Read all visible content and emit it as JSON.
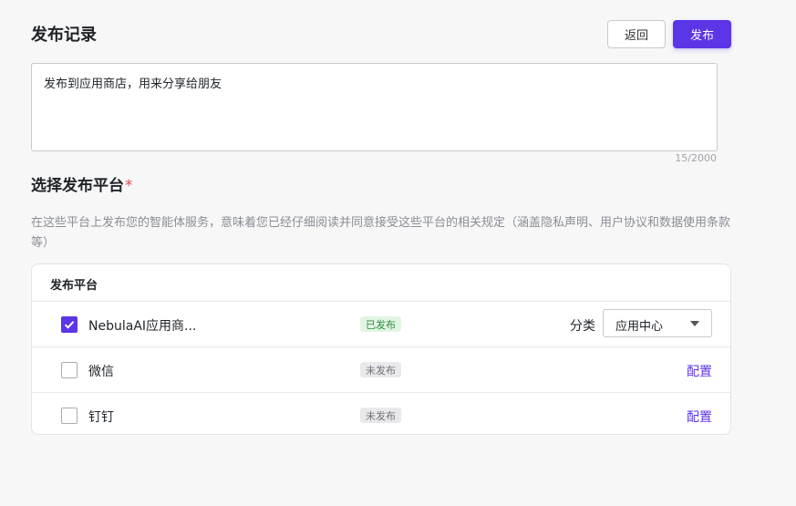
{
  "header": {
    "title": "发布记录",
    "back_label": "返回",
    "publish_label": "发布"
  },
  "notes": {
    "value": "发布到应用商店，用来分享给朋友",
    "counter": "15/2000"
  },
  "platform_section": {
    "title": "选择发布平台",
    "required_mark": "*",
    "description": "在这些平台上发布您的智能体服务，意味着您已经仔细阅读并同意接受这些平台的相关规定（涵盖隐私声明、用户协议和数据使用条款等）"
  },
  "table": {
    "header": "发布平台",
    "rows": [
      {
        "name": "NebulaAI应用商...",
        "checked": true,
        "status": "已发布",
        "category_label": "分类",
        "category_value": "应用中心"
      },
      {
        "name": "微信",
        "checked": false,
        "status": "未发布",
        "action": "配置"
      },
      {
        "name": "钉钉",
        "checked": false,
        "status": "未发布",
        "action": "配置"
      }
    ]
  },
  "colors": {
    "accent": "#5b35e6",
    "published_bg": "#e2f5e4",
    "published_text": "#2e8a3d",
    "unpublished_bg": "#e9e9ec",
    "required": "#e5484d"
  }
}
